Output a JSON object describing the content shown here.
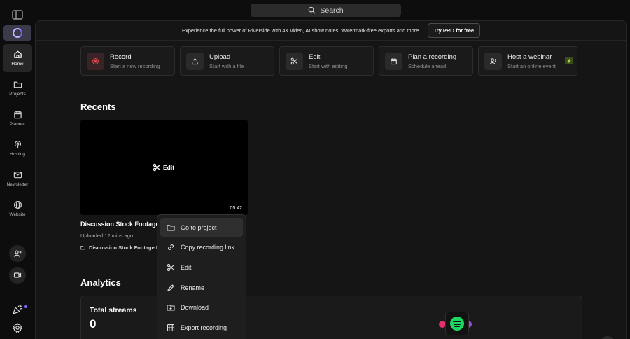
{
  "search": {
    "label": "Search"
  },
  "nav": {
    "items": [
      {
        "id": "home",
        "label": "Home",
        "icon": "home-icon"
      },
      {
        "id": "projects",
        "label": "Projects",
        "icon": "folder-icon"
      },
      {
        "id": "planner",
        "label": "Planner",
        "icon": "calendar-icon"
      },
      {
        "id": "hosting",
        "label": "Hosting",
        "icon": "podcast-icon"
      },
      {
        "id": "newsletter",
        "label": "Newsletter",
        "icon": "mail-icon"
      },
      {
        "id": "website",
        "label": "Website",
        "icon": "globe-icon"
      }
    ]
  },
  "banner": {
    "text": "Experience the full power of Riverside with 4K video, AI show notes, watermark-free exports and more.",
    "cta": "Try PRO for free"
  },
  "quick_actions": [
    {
      "title": "Record",
      "subtitle": "Start a new recording"
    },
    {
      "title": "Upload",
      "subtitle": "Start with a file"
    },
    {
      "title": "Edit",
      "subtitle": "Start with editing"
    },
    {
      "title": "Plan a recording",
      "subtitle": "Schedule ahead"
    },
    {
      "title": "Host a webinar",
      "subtitle": "Start an online event"
    }
  ],
  "recents": {
    "title": "Recents",
    "item": {
      "edit_label": "Edit",
      "duration": "05:42",
      "name": "Discussion Stock Footage",
      "uploaded": "Uploaded 12 mins ago",
      "folder": "Discussion Stock Footage D"
    }
  },
  "context_menu": {
    "items": [
      "Go to project",
      "Copy recording link",
      "Edit",
      "Rename",
      "Download",
      "Export recording"
    ]
  },
  "analytics": {
    "title": "Analytics",
    "total_streams_label": "Total streams",
    "total_streams_value": "0"
  },
  "colors": {
    "accent": "#6c63ff",
    "record": "#e5484d",
    "spotify": "#1ed760",
    "pro_bolt": "#b6f03d"
  }
}
